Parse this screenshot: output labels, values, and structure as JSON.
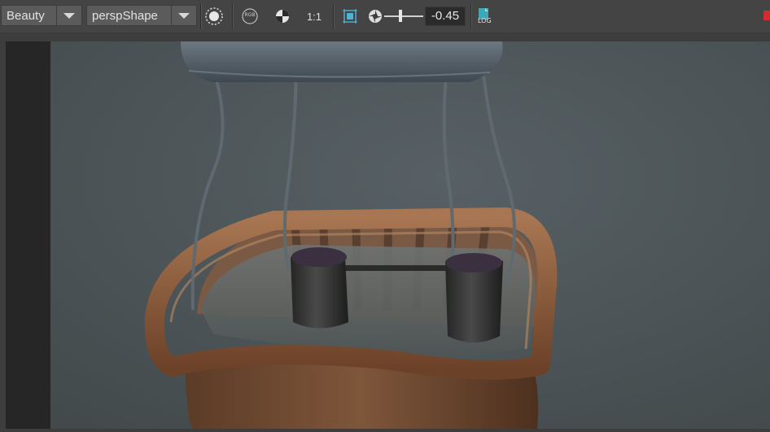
{
  "toolbar": {
    "channel_dropdown": {
      "value": "Beauty",
      "icon": "chevron-down-icon"
    },
    "camera_dropdown": {
      "value": "perspShape",
      "icon": "chevron-down-icon"
    },
    "icons": {
      "render_region": "render-region-icon",
      "rgb_channel": "rgb-channel-icon",
      "rgb_label": "RGB",
      "alpha_channel": "alpha-checker-icon",
      "ratio_label": "1:1",
      "frame_icon": "frame-region-icon",
      "exposure_icon": "exposure-aperture-icon",
      "log_icon": "log-file-icon",
      "log_label": "LOG"
    },
    "exposure_value": "-0.45",
    "exposure_slider_fraction": 0.45
  },
  "colors": {
    "toolbar_bg": "#444444",
    "dropdown_bg": "#5b5b5b",
    "viewport_bg": "#3d3d3d",
    "render_bg": "#4b5455",
    "accent_red": "#d62b2b",
    "bucket_brown": "#8a5a3a",
    "log_teal": "#3fa7b8"
  }
}
